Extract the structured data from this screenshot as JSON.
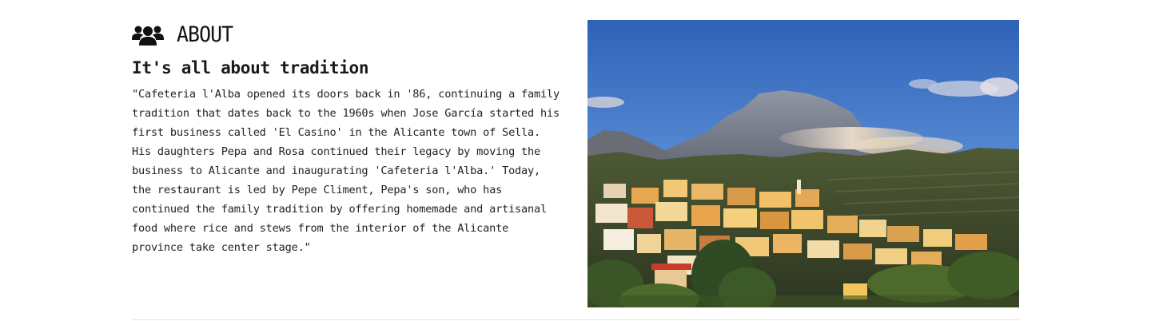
{
  "about": {
    "icon": "users-icon",
    "title": "ABOUT",
    "subtitle": "It's all about tradition",
    "paragraph": "\"Cafeteria l'Alba opened its doors back in '86, continuing a family\ntradition that dates back to the 1960s when Jose García started his\nfirst business called 'El Casino' in the Alicante town of Sella.\nHis daughters Pepa and Rosa continued their legacy by moving the\nbusiness to Alicante and inaugurating 'Cafeteria l'Alba.' Today,\nthe restaurant is led by Pepe Climent, Pepa's son, who has\ncontinued the family tradition by offering homemade and artisanal\nfood where rice and stews from the interior of the Alicante\nprovince take center stage.\"",
    "image": {
      "subject": "hillside-village-photo"
    }
  },
  "colors": {
    "text": "#222222",
    "sky": "#4a7ec9",
    "mountain": "#7a7f8c",
    "hills": "#3a4a2a",
    "houses": "#e0b25a",
    "divider": "#e6e6e6"
  }
}
